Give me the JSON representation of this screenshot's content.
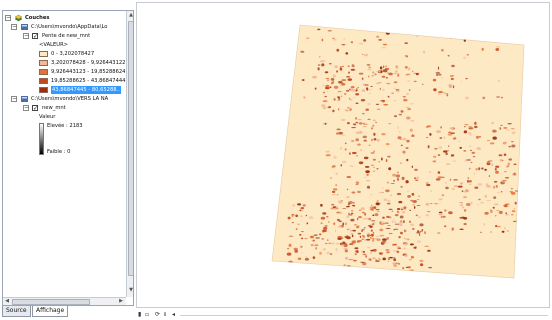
{
  "toc": {
    "root_label": "Couches",
    "layers": [
      {
        "path": "C:\\Users\\mvondo\\AppData\\Lo",
        "name": "Pente de new_mnt",
        "field": "<VALEUR>",
        "classes": [
          {
            "label": "0 - 3,202078427",
            "color": "#fde9c4"
          },
          {
            "label": "3,202078428 - 9,926443122",
            "color": "#f3b79a"
          },
          {
            "label": "9,926443123 - 19,85288624",
            "color": "#e4733a"
          },
          {
            "label": "19,85288625 - 43,86847444",
            "color": "#c3461c"
          },
          {
            "label": "43,86847445 - 80,65288..",
            "color": "#9a2e0e"
          }
        ]
      },
      {
        "path": "C:\\Users\\mvondo\\VERS LA NA",
        "name": "new_mnt",
        "field": "Valeur",
        "high_label": "Elevée : 2183",
        "low_label": "Faible : 0"
      }
    ]
  },
  "tabs": [
    {
      "label": "Source"
    },
    {
      "label": "Affichage"
    }
  ],
  "colors": {
    "selection": "#3399ff",
    "map_background": "#fde9c4",
    "slope_dark": "#d04a14"
  },
  "icons": {
    "expander": "minus",
    "checkbox": "checked"
  }
}
